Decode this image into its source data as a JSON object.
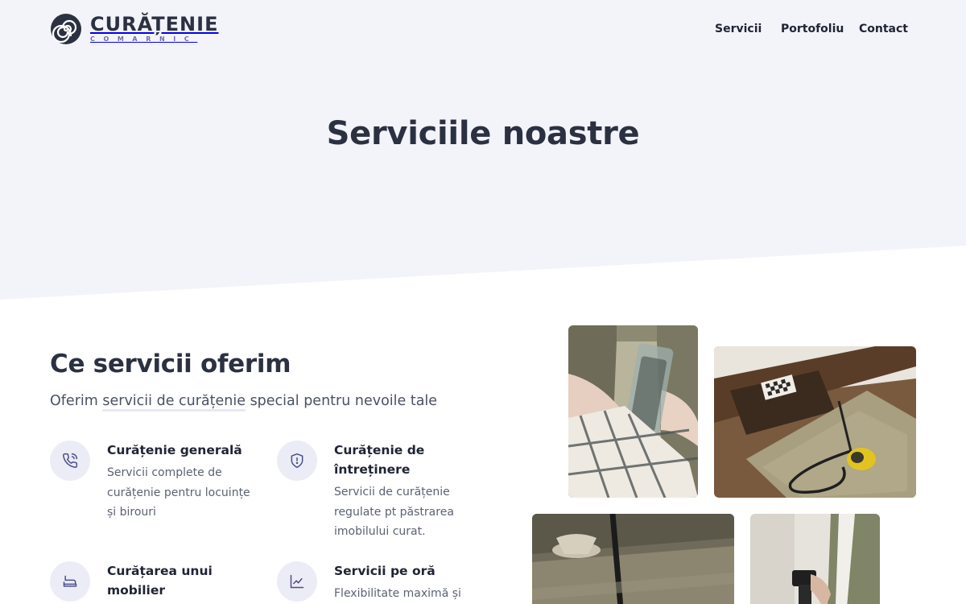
{
  "brand": {
    "name": "CURĂȚENIE",
    "subtitle": "COMARNIC"
  },
  "nav": {
    "items": [
      "Servicii",
      "Portofoliu",
      "Contact"
    ]
  },
  "hero": {
    "title": "Serviciile noastre"
  },
  "services_section": {
    "title": "Ce servicii oferim",
    "subtitle_before": "Oferim ",
    "subtitle_highlight": "servicii de curățenie",
    "subtitle_after": " special pentru nevoile tale",
    "items": [
      {
        "title": "Curățenie generală",
        "description": "Servicii complete de curățenie pentru locuințe și birouri",
        "icon": "phone-icon"
      },
      {
        "title": "Curățenie de întreținere",
        "description": "Servicii de curățenie regulate pt păstrarea imobilului curat.",
        "icon": "shield-icon"
      },
      {
        "title": "Curățarea unui mobilier",
        "description": "",
        "icon": "sofa-icon"
      },
      {
        "title": "Servicii pe oră",
        "description": "Flexibilitate maximă și",
        "icon": "chart-line-icon"
      }
    ]
  },
  "colors": {
    "hero_bg": "#f3f3fa",
    "icon_bg": "#ececf7",
    "accent": "#6b6fa3",
    "text_dark": "#2b3141"
  }
}
